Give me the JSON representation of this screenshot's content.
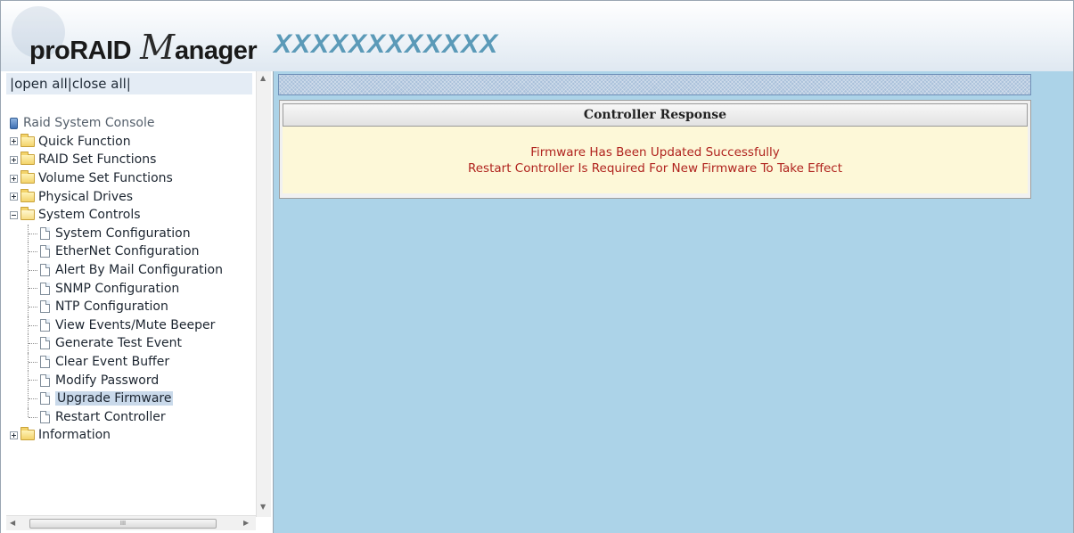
{
  "header": {
    "logo_pro": "proRAID",
    "logo_m": "M",
    "logo_anager": "anager",
    "model_name": "XXXXXXXXXXXX"
  },
  "nav": {
    "open_all": "open all",
    "close_all": "close all",
    "root_label": "Raid System Console",
    "folders": [
      {
        "label": "Quick Function",
        "expanded": false
      },
      {
        "label": "RAID Set Functions",
        "expanded": false
      },
      {
        "label": "Volume Set Functions",
        "expanded": false
      },
      {
        "label": "Physical Drives",
        "expanded": false
      },
      {
        "label": "System Controls",
        "expanded": true
      },
      {
        "label": "Information",
        "expanded": false
      }
    ],
    "system_controls_items": [
      "System Configuration",
      "EtherNet Configuration",
      "Alert By Mail Configuration",
      "SNMP Configuration",
      "NTP Configuration",
      "View Events/Mute Beeper",
      "Generate Test Event",
      "Clear Event Buffer",
      "Modify Password",
      "Upgrade Firmware",
      "Restart Controller"
    ],
    "selected_item": "Upgrade Firmware"
  },
  "scrollbar": {
    "thumb_grip": "III"
  },
  "response": {
    "title": "Controller Response",
    "line1": "Firmware Has Been Updated Successfully",
    "line2": "Restart Controller Is Required For New Firmware To Take Effect"
  },
  "colors": {
    "content_bg": "#acd3e8",
    "message_text": "#b0231e",
    "message_bg": "#fdf8d8",
    "model_name": "#5b9ab8"
  }
}
